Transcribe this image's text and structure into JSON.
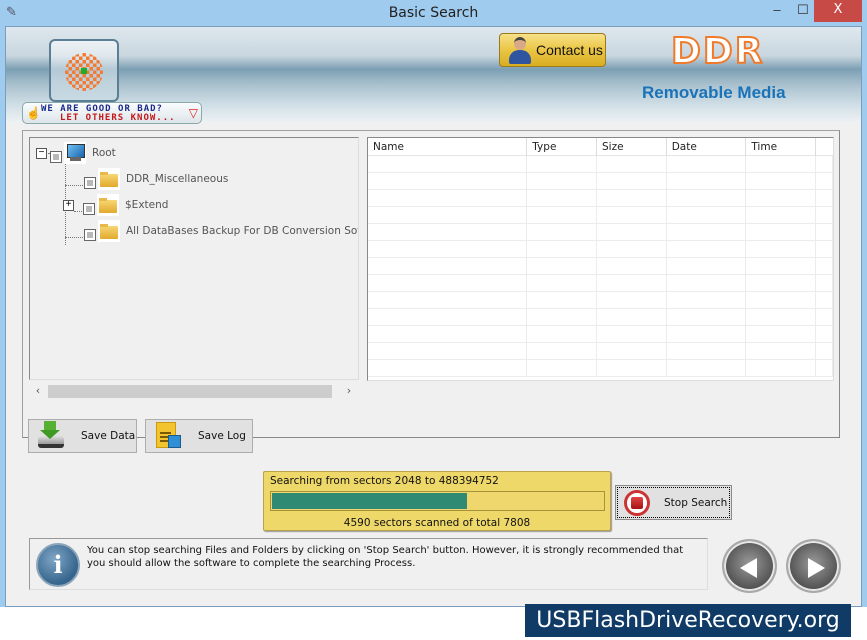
{
  "window": {
    "title": "Basic Search",
    "controls": {
      "minimize": "‒",
      "maximize": "☐",
      "close": "X"
    }
  },
  "banner": {
    "contact_label": "Contact us",
    "brand": "DDR",
    "product": "Removable Media"
  },
  "feedback": {
    "line1": "WE ARE GOOD OR BAD?",
    "line2": "LET OTHERS KNOW...",
    "thumb_up": "👍",
    "thumb_down": "👎"
  },
  "tree": {
    "root": {
      "label": "Root",
      "expander": "−",
      "icon": "monitor-icon"
    },
    "children": [
      {
        "label": "DDR_Miscellaneous",
        "icon": "folder-icon",
        "expander": ""
      },
      {
        "label": "$Extend",
        "icon": "folder-icon",
        "expander": "+"
      },
      {
        "label": "All DataBases Backup For DB Conversion Software",
        "icon": "folder-icon",
        "expander": ""
      }
    ],
    "scroll_left": "‹",
    "scroll_right": "›"
  },
  "list": {
    "columns": [
      "Name",
      "Type",
      "Size",
      "Date",
      "Time"
    ],
    "rows": []
  },
  "buttons": {
    "save_data": "Save Data",
    "save_log": "Save Log",
    "stop_search": "Stop Search"
  },
  "progress": {
    "range_text": "Searching from sectors 2048 to 488394752",
    "scanned": 4590,
    "total": 7808,
    "status_text": "4590  sectors scanned of total 7808",
    "fraction": 0.588,
    "fill_color": "#2f8a73"
  },
  "info": {
    "message": "You can stop searching Files and Folders by clicking on 'Stop Search' button. However, it is strongly recommended that you should allow the software to complete the searching Process.",
    "icon_glyph": "i"
  },
  "footer": {
    "watermark": "USBFlashDriveRecovery.org"
  }
}
